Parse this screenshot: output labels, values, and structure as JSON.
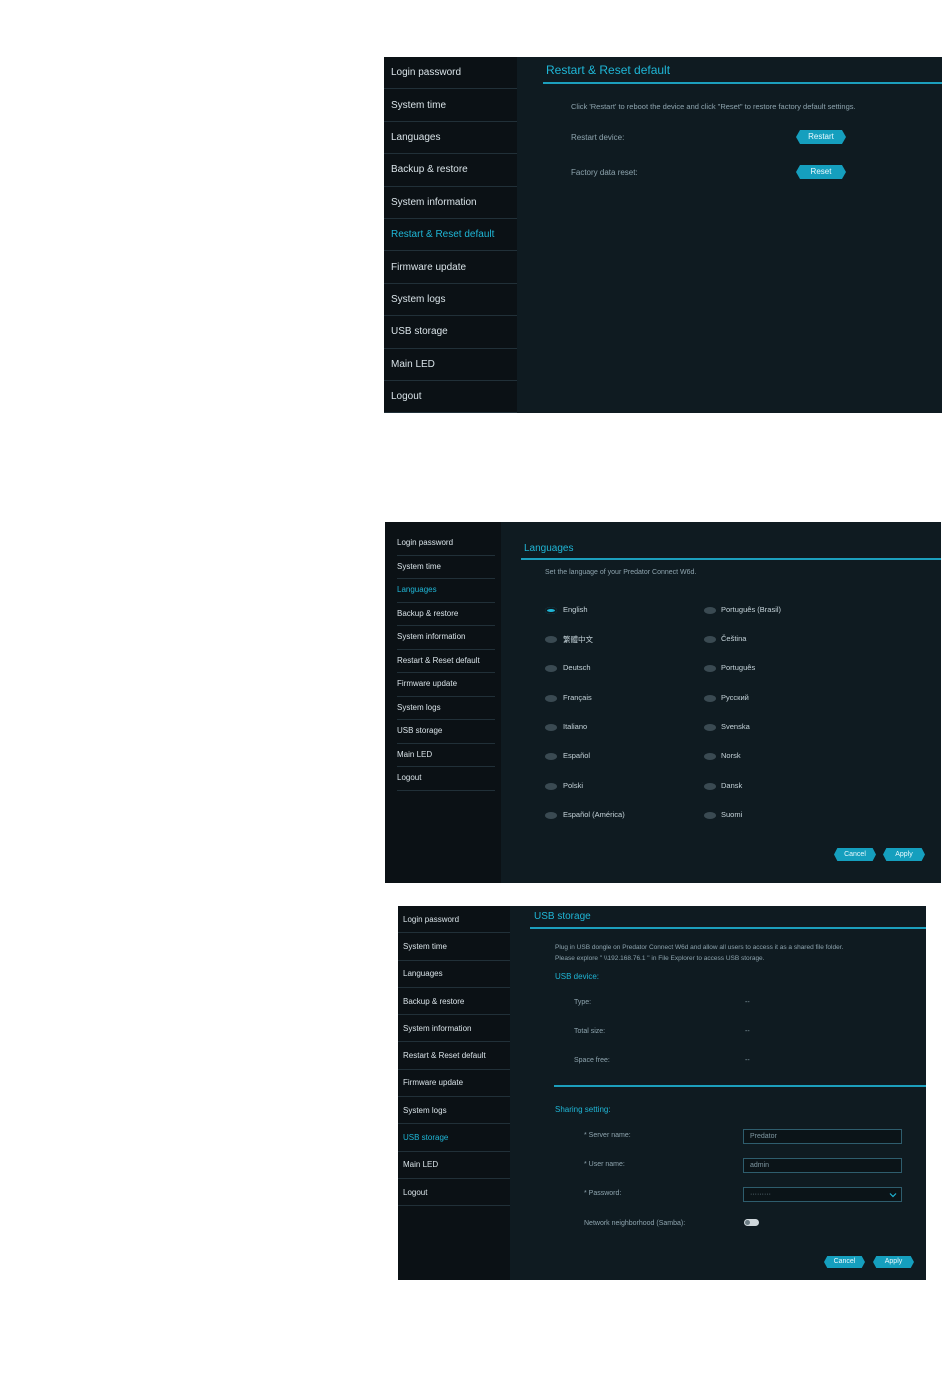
{
  "sidebar_items": [
    "Login password",
    "System time",
    "Languages",
    "Backup & restore",
    "System information",
    "Restart & Reset default",
    "Firmware update",
    "System logs",
    "USB storage",
    "Main LED",
    "Logout"
  ],
  "panel1": {
    "title": "Restart & Reset default",
    "description": "Click 'Restart' to reboot the device and click \"Reset\" to restore factory default settings.",
    "restart_label": "Restart device:",
    "restart_button": "Restart",
    "reset_label": "Factory data reset:",
    "reset_button": "Reset"
  },
  "panel2": {
    "title": "Languages",
    "description": "Set the language of your Predator Connect W6d.",
    "selected": "English",
    "left_column": [
      "English",
      "繁體中文",
      "Deutsch",
      "Français",
      "Italiano",
      "Español",
      "Polski",
      "Español (América)"
    ],
    "right_column": [
      "Português (Brasil)",
      "Čeština",
      "Português",
      "Русский",
      "Svenska",
      "Norsk",
      "Dansk",
      "Suomi"
    ],
    "cancel_button": "Cancel",
    "apply_button": "Apply"
  },
  "panel3": {
    "title": "USB storage",
    "description_line1": "Plug in USB dongle on Predator Connect W6d and allow all users to access it as a shared file folder.",
    "description_line2": "Please explore \" \\\\192.168.76.1 \" in File Explorer to access USB storage.",
    "usb_device_heading": "USB device:",
    "type_label": "Type:",
    "type_value": "--",
    "total_size_label": "Total size:",
    "total_size_value": "--",
    "space_free_label": "Space free:",
    "space_free_value": "--",
    "sharing_heading": "Sharing setting:",
    "server_name_label": "* Server name:",
    "server_name_value": "Predator",
    "user_name_label": "* User name:",
    "user_name_value": "admin",
    "password_label": "* Password:",
    "password_value": "·········",
    "samba_label": "Network neighborhood (Samba):",
    "samba_enabled": false,
    "cancel_button": "Cancel",
    "apply_button": "Apply"
  },
  "colors": {
    "accent": "#1fb6d6",
    "button": "#159fbe",
    "background": "#0f1b21",
    "sidebar": "#0b1115"
  }
}
